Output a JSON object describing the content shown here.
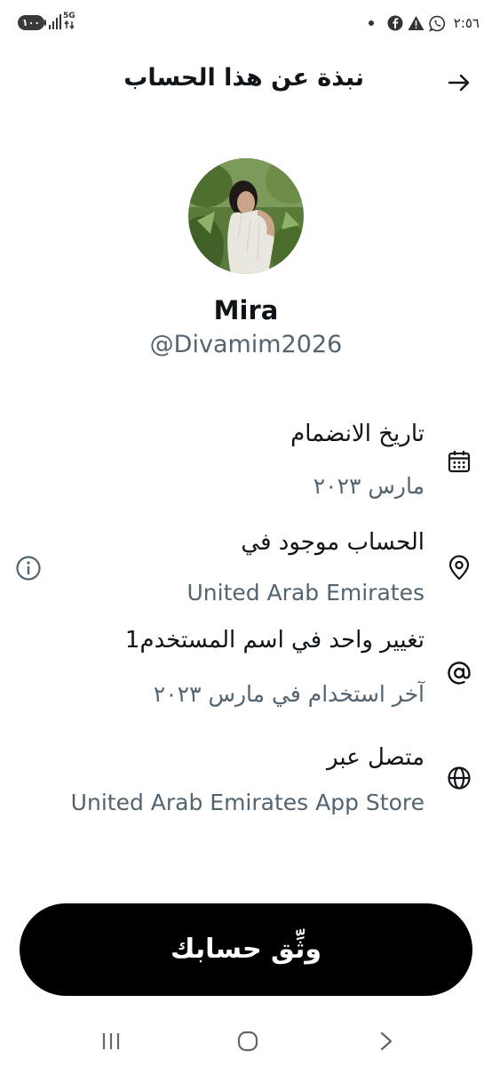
{
  "status_bar": {
    "battery": "١٠٠",
    "network": "5G",
    "time": "٢:٥٦",
    "icons": [
      "signal-icon",
      "whatsapp-icon",
      "warning-icon",
      "facebook-icon",
      "notification-dot-icon"
    ]
  },
  "header": {
    "title": "نبذة عن هذا الحساب",
    "back_icon": "arrow-right-icon"
  },
  "profile": {
    "name": "Mira",
    "handle": "@Divamim2026",
    "avatar_icon": "profile-photo"
  },
  "info": {
    "joined": {
      "title": "تاريخ الانضمام",
      "value": "مارس ٢٠٢٣",
      "icon": "calendar-icon"
    },
    "location": {
      "title": "الحساب موجود في",
      "value": "United Arab Emirates",
      "icon": "location-pin-icon",
      "extra_icon": "info-icon"
    },
    "username": {
      "title": "تغيير واحد في اسم المستخدم1",
      "value": "آخر استخدام في مارس ٢٠٢٣",
      "icon": "at-sign-icon"
    },
    "connected": {
      "title": "متصل عبر",
      "value": "United Arab Emirates App Store",
      "icon": "globe-icon"
    }
  },
  "actions": {
    "verify_label": "وثِّق حسابك"
  },
  "nav": {
    "icons": [
      "recent-apps-icon",
      "home-icon",
      "back-icon"
    ]
  },
  "colors": {
    "primary_text": "#0f1419",
    "secondary_text": "#536471",
    "button_bg": "#000000",
    "button_text": "#ffffff"
  }
}
